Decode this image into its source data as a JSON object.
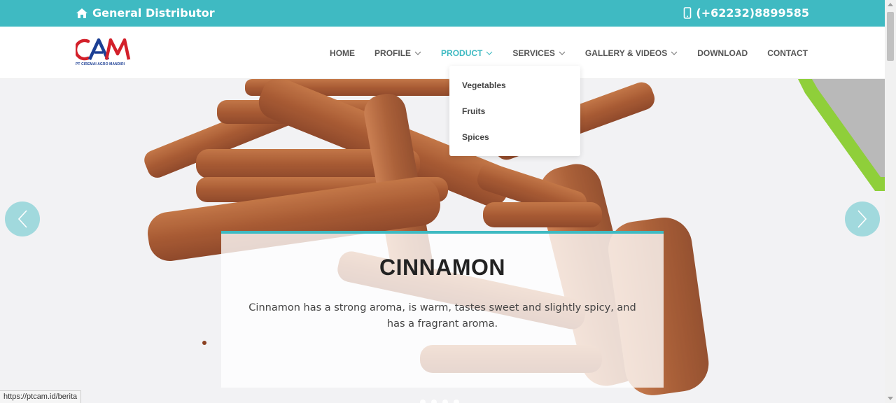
{
  "topbar": {
    "tagline": "General Distributor",
    "tagline_icon": "home-icon",
    "phone": "(+62232)8899585",
    "phone_icon": "mobile-phone-icon",
    "background_color": "#3fbac2"
  },
  "logo": {
    "text": "CAM",
    "subtitle": "PT CIREMAI AGRO MANDIRI"
  },
  "nav": {
    "items": [
      {
        "label": "HOME",
        "has_dropdown": false
      },
      {
        "label": "PROFILE",
        "has_dropdown": true
      },
      {
        "label": "PRODUCT",
        "has_dropdown": true,
        "active": true
      },
      {
        "label": "SERVICES",
        "has_dropdown": true
      },
      {
        "label": "GALLERY & VIDEOS",
        "has_dropdown": true
      },
      {
        "label": "DOWNLOAD",
        "has_dropdown": false
      },
      {
        "label": "CONTACT",
        "has_dropdown": false
      }
    ],
    "active_color": "#3fbac2"
  },
  "product_dropdown": {
    "items": [
      "Vegetables",
      "Fruits",
      "Spices"
    ]
  },
  "hero": {
    "title": "CINNAMON",
    "description": "Cinnamon has a strong aroma, is warm, tastes sweet and slightly spicy, and has a fragrant aroma.",
    "prev_icon": "chevron-left-icon",
    "next_icon": "chevron-right-icon"
  },
  "status_bar": {
    "url": "https://ptcam.id/berita"
  }
}
